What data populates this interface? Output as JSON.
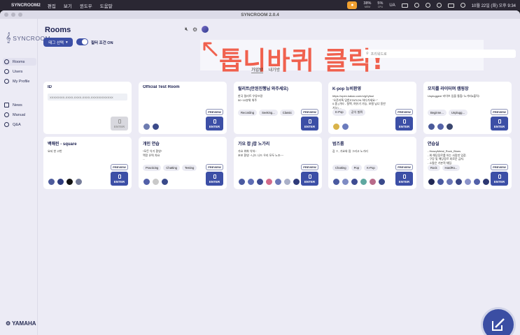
{
  "menubar": {
    "app": "SYNCROOM2",
    "items": [
      "편집",
      "보기",
      "윈도우",
      "도움말"
    ],
    "net": "38%",
    "net_sub": "MEM",
    "cpu": "5%",
    "cpu_sub": "CPU",
    "input": "UA",
    "clock": "10월 22일 (화) 오후 9:34"
  },
  "window": {
    "title": "SYNCROOM 2.0.4"
  },
  "sidebar": {
    "logo": "SYNCROOM",
    "items": [
      {
        "label": "Rooms",
        "icon": "rooms-icon"
      },
      {
        "label": "Users",
        "icon": "users-icon"
      },
      {
        "label": "My Profile",
        "icon": "profile-icon"
      },
      {
        "label": "News",
        "icon": "news-icon"
      },
      {
        "label": "Manual",
        "icon": "manual-icon"
      },
      {
        "label": "Q&A",
        "icon": "qa-icon"
      }
    ],
    "brand": "YAMAHA"
  },
  "header": {
    "title": "Rooms",
    "tag_button": "태그 선택",
    "filter_label": "필터 조건 ON",
    "search_placeholder": "프리워드로",
    "tabs": [
      "가입방",
      "내가방"
    ],
    "accent": "#3c4fa6"
  },
  "annotation": {
    "text": "톱니바퀴 클릭!",
    "color": "#f0614e"
  },
  "buttons": {
    "preview": "PREVIEW",
    "enter": "ENTER"
  },
  "rooms": [
    {
      "title": "ID",
      "id_value": "XXXXXXXX-XXXX-XXXX-XXXX-XXXXXXXXXXXX",
      "desc": "",
      "tags": [],
      "enter_disabled": true,
      "preview": false,
      "avatars": []
    },
    {
      "title": "Official Test Room",
      "desc": "",
      "tags": [],
      "preview": true,
      "avatars": [
        "#6d7bb0",
        "#3b4a8a"
      ]
    },
    {
      "title": "릴리트(안된진행님 와주세요)",
      "desc": "한국 릴리트 우뮤쓰랑\n50~10분위 위주",
      "tags": [
        "Recording",
        "Seeking...",
        "Classic"
      ],
      "preview": true,
      "avatars": []
    },
    {
      "title": "K-pop 뉴비환영",
      "desc": "https://open.kakao.com/o/gXyfuul\n\"오픈카톡 잊힌STATION 하다가세요~\"\n0.좀 (기타 - 질백, 여유기 가능, 보컬 님너 동반\n가능) ...",
      "tags": [
        "K-Pop",
        "공익 칠튀"
      ],
      "preview": true,
      "avatars": [
        "#d9b34a",
        "#6b7bbd"
      ]
    },
    {
      "title": "모지를 라이터며 캠핑장",
      "desc": "Unplugged/ 라이브 입을 통합/ 노가비&플릭/",
      "tags": [
        "Beginne...",
        "Unplugg..."
      ],
      "preview": true,
      "avatars": [
        "#4a5a9a",
        "#5563a8",
        "#3a466e"
      ]
    },
    {
      "title": "백해린 - square",
      "desc": "요되 한 고반",
      "tags": [],
      "preview": true,
      "avatars": [
        "#4e5c9c",
        "#2f3c7c",
        "#111111",
        "#777e9a"
      ]
    },
    {
      "title": "개인 연습",
      "desc": "*모든 악기 환영*\n맥랑 유력 차요\n...",
      "tags": [
        "Practicing",
        "Chatting",
        "Testing"
      ],
      "preview": true,
      "avatars": [
        "#5260a8",
        "#c9c9c9",
        "#3a4a8a"
      ]
    },
    {
      "title": "가요 팝 j팝 노가리",
      "desc": "가요 위화 악하~\n초보 환영 ~니드 나드 우리 모두 노조~~",
      "tags": [],
      "preview": true,
      "avatars": [
        "#4a5aa0",
        "#5f6eb5",
        "#3e4c92",
        "#d36b8a",
        "#6b78b8",
        "#aab0c8",
        "#2f3b7a",
        "#5567b0"
      ]
    },
    {
      "title": "범즈룸",
      "desc": "갑 ㅈ, 가요와 팝 그리고 노가리",
      "tags": [
        "Chatting",
        "Pop",
        "K-Pop"
      ],
      "preview": true,
      "avatars": [
        "#4a5aa0",
        "#7f8cc4",
        "#3e4c92",
        "#5fa8a0",
        "#b86b8a",
        "#3a4a8a"
      ]
    },
    {
      "title": "연습실",
      "desc": "- HeavyMetal_Rock_Blues\n- 위 해당장르를 하는 사람만 입장.\n- 구강 및 해당장르 외로운 금지.\n- 소통은 기본적 채팅.",
      "tags": [
        "Rock",
        "HardRo..."
      ],
      "preview": true,
      "avatars": [
        "#222a55",
        "#4a5aa0",
        "#6a76b4",
        "#3a4684",
        "#8b93c9",
        "#5260a8",
        "#2d3872"
      ]
    }
  ]
}
